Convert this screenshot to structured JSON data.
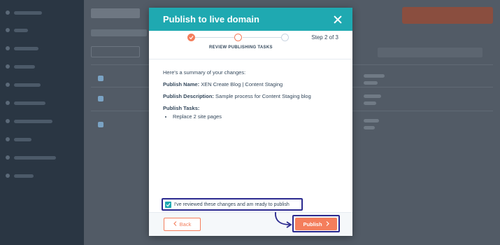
{
  "modal": {
    "title": "Publish to live domain",
    "stepper": {
      "label": "REVIEW PUBLISHING TASKS",
      "counter": "Step 2 of 3"
    },
    "summary": {
      "intro": "Here's a summary of your changes:",
      "name_label": "Publish Name:",
      "name_value": "XEN Create Blog | Content Staging",
      "description_label": "Publish Description:",
      "description_value": "Sample process for Content Staging blog",
      "tasks_label": "Publish Tasks:",
      "tasks": [
        "Replace 2 site pages"
      ]
    },
    "confirm": {
      "label": "I've reviewed these changes and am ready to publish",
      "checked": true
    },
    "footer": {
      "back_label": "Back",
      "publish_label": "Publish"
    }
  },
  "colors": {
    "header": "#1fa9b1",
    "accent": "#f47e5c",
    "highlight": "#2b2a8f"
  }
}
